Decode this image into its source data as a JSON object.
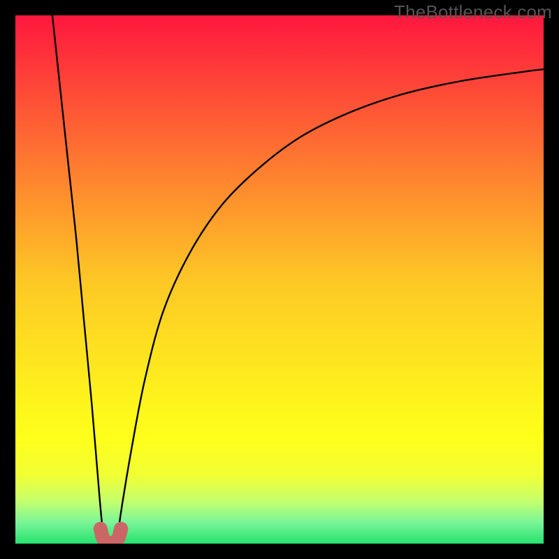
{
  "watermark": "TheBottleneck.com",
  "chart_data": {
    "type": "line",
    "title": "",
    "xlabel": "",
    "ylabel": "",
    "xlim": [
      0,
      100
    ],
    "ylim": [
      0,
      100
    ],
    "background_gradient": {
      "stops": [
        {
          "offset": 0.0,
          "color": "#ff173e"
        },
        {
          "offset": 0.25,
          "color": "#fe6f32"
        },
        {
          "offset": 0.5,
          "color": "#fdc725"
        },
        {
          "offset": 0.72,
          "color": "#fef21c"
        },
        {
          "offset": 0.8,
          "color": "#feff1a"
        },
        {
          "offset": 0.87,
          "color": "#f2ff34"
        },
        {
          "offset": 0.92,
          "color": "#c4ff6e"
        },
        {
          "offset": 0.96,
          "color": "#79f598"
        },
        {
          "offset": 1.0,
          "color": "#26e26e"
        }
      ]
    },
    "series": [
      {
        "name": "left-branch",
        "x": [
          7.0,
          8.5,
          10.0,
          11.5,
          13.0,
          14.5,
          16.0,
          16.8
        ],
        "y": [
          100,
          86,
          72,
          58,
          42,
          26,
          8,
          0
        ]
      },
      {
        "name": "right-branch",
        "x": [
          19.2,
          20.0,
          22.0,
          24.5,
          28.0,
          33.0,
          39.0,
          46.0,
          54.0,
          63.0,
          73.0,
          84.0,
          96.0,
          100.0
        ],
        "y": [
          0,
          6,
          18,
          31,
          44,
          55,
          64,
          71,
          77,
          81.5,
          85,
          87.5,
          89.3,
          89.8
        ]
      }
    ],
    "valley_bottom": {
      "comment": "small red U-shaped marker cluster at the trough",
      "points_x": [
        16.1,
        16.6,
        17.3,
        18.0,
        18.8,
        19.5,
        20.0
      ],
      "points_y": [
        2.8,
        1.0,
        0.3,
        0.1,
        0.3,
        1.0,
        2.8
      ],
      "dot_color": "#cc6666",
      "dot_radius": 10
    },
    "curve_color": "#000000",
    "curve_width": 2.4
  }
}
